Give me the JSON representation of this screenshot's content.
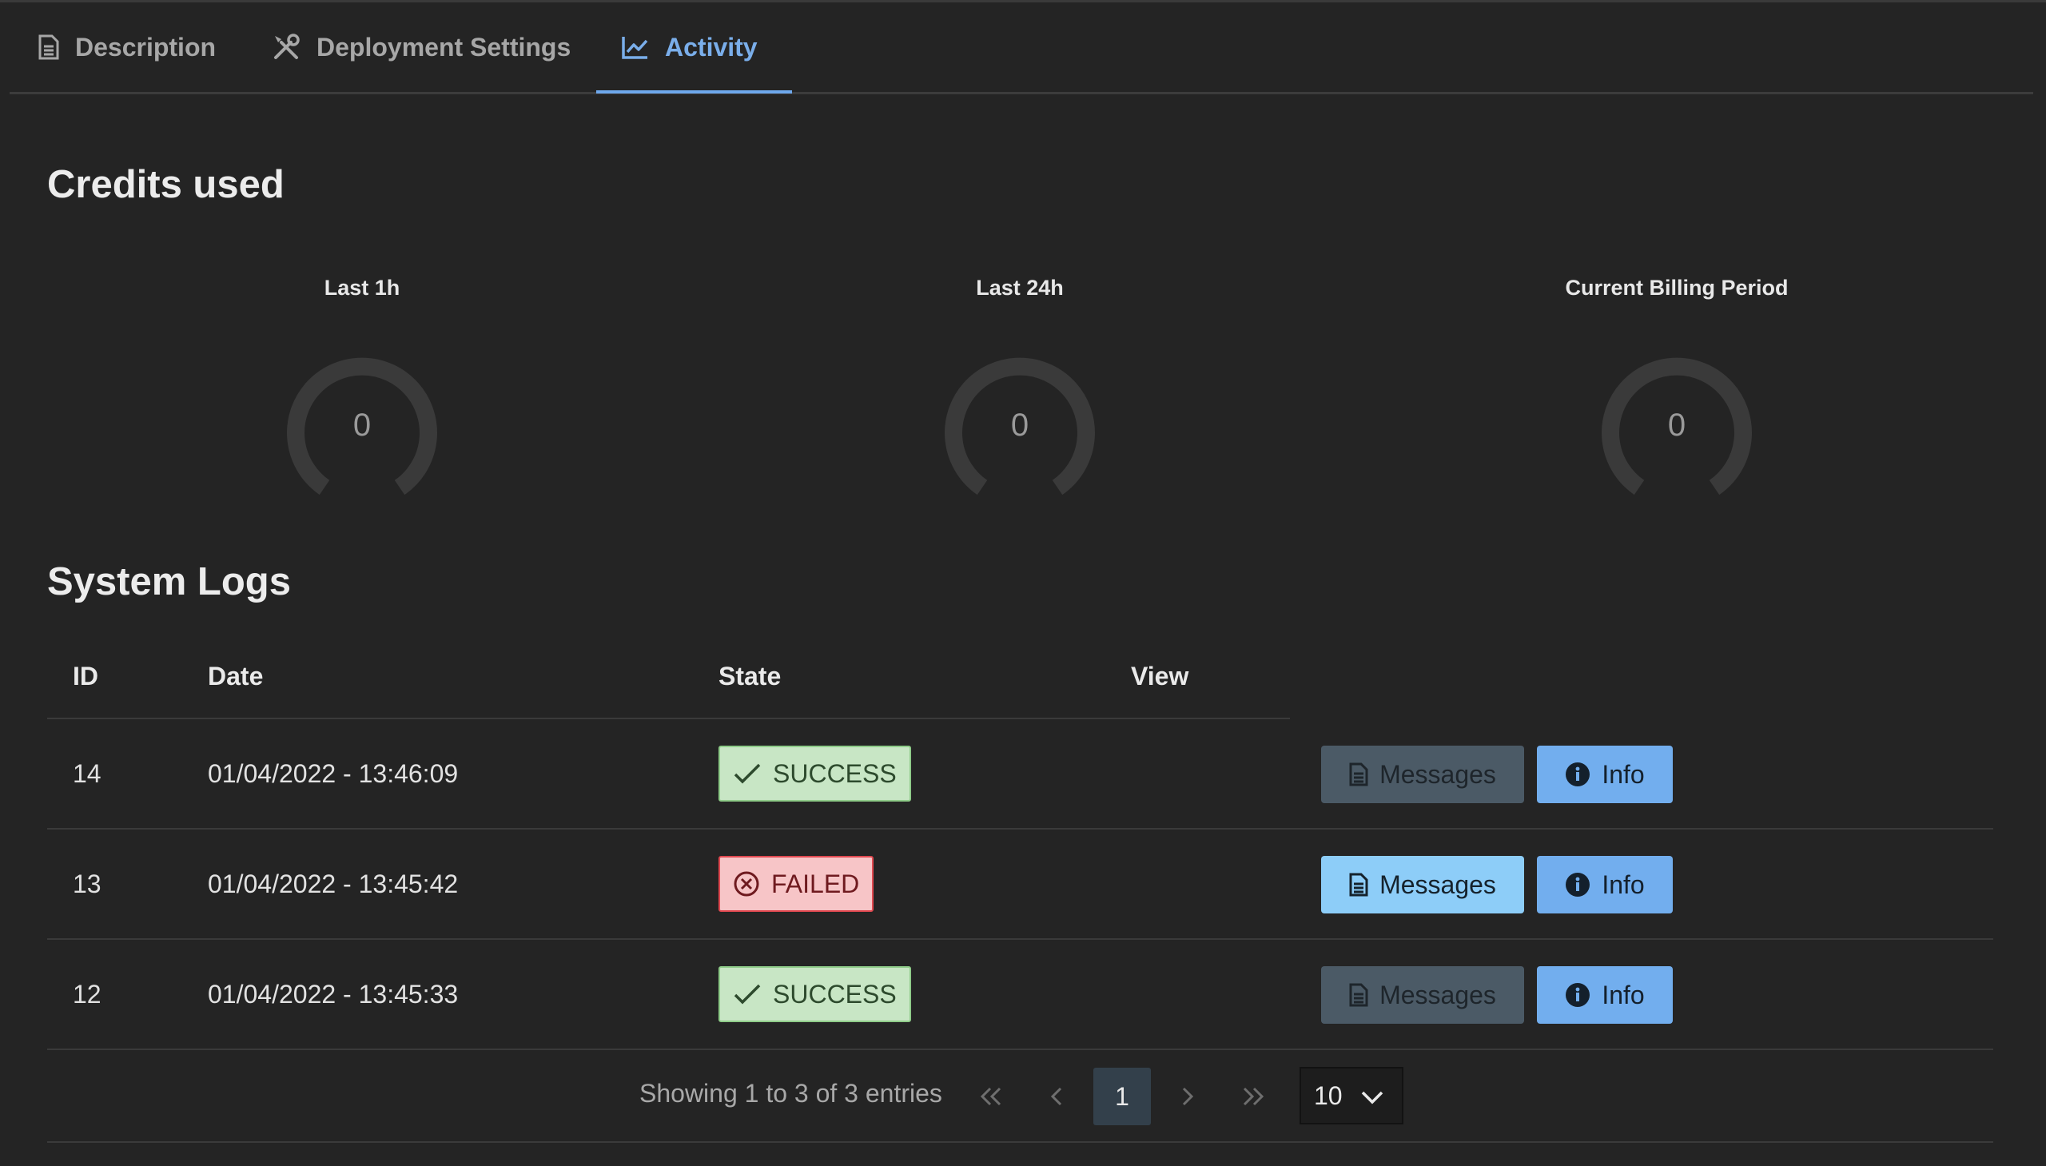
{
  "tabs": [
    {
      "label": "Description",
      "icon": "document-icon"
    },
    {
      "label": "Deployment Settings",
      "icon": "tools-icon"
    },
    {
      "label": "Activity",
      "icon": "chart-line-icon",
      "active": true
    }
  ],
  "credits": {
    "title": "Credits used",
    "gauges": [
      {
        "label": "Last 1h",
        "value": "0"
      },
      {
        "label": "Last 24h",
        "value": "0"
      },
      {
        "label": "Current Billing Period",
        "value": "0"
      }
    ]
  },
  "logs": {
    "title": "System Logs",
    "columns": {
      "id": "ID",
      "date": "Date",
      "state": "State",
      "view": "View"
    },
    "rows": [
      {
        "id": "14",
        "date": "01/04/2022 - 13:46:09",
        "state": "SUCCESS",
        "messages": "Messages",
        "info": "Info"
      },
      {
        "id": "13",
        "date": "01/04/2022 - 13:45:42",
        "state": "FAILED",
        "messages": "Messages",
        "info": "Info"
      },
      {
        "id": "12",
        "date": "01/04/2022 - 13:45:33",
        "state": "SUCCESS",
        "messages": "Messages",
        "info": "Info"
      }
    ],
    "pagination": {
      "summary": "Showing 1 to 3 of 3 entries",
      "current_page": "1",
      "per_page": "10"
    }
  },
  "colors": {
    "accent": "#7aaeea",
    "success_bg": "#c8e6c5",
    "failed_bg": "#f7c5c7",
    "info_button": "#72aeee",
    "messages_active": "#8dcdf8"
  }
}
